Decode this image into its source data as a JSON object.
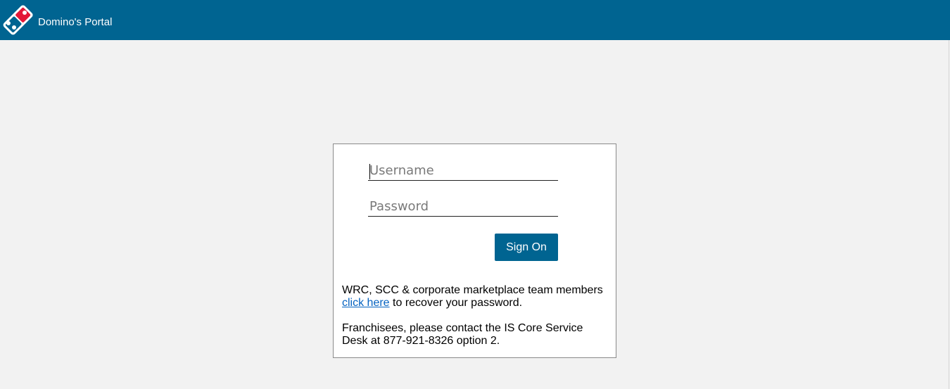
{
  "header": {
    "title": "Domino's Portal",
    "logo_icon": "dominos-domino-logo-icon",
    "background_color": "#006491"
  },
  "login": {
    "username": {
      "value": "",
      "placeholder": "Username"
    },
    "password": {
      "value": "",
      "placeholder": "Password"
    },
    "sign_on_label": "Sign On",
    "recovery": {
      "text_before": "WRC, SCC & corporate marketplace team members",
      "link_label": "click here",
      "text_after": " to recover your password."
    },
    "franchisee_note": "Franchisees, please contact the IS Core Service Desk at 877-921-8326 option 2."
  },
  "colors": {
    "accent": "#006491",
    "logo_red": "#e31837",
    "link": "#0563c1",
    "page_background": "#f2f2f2"
  }
}
